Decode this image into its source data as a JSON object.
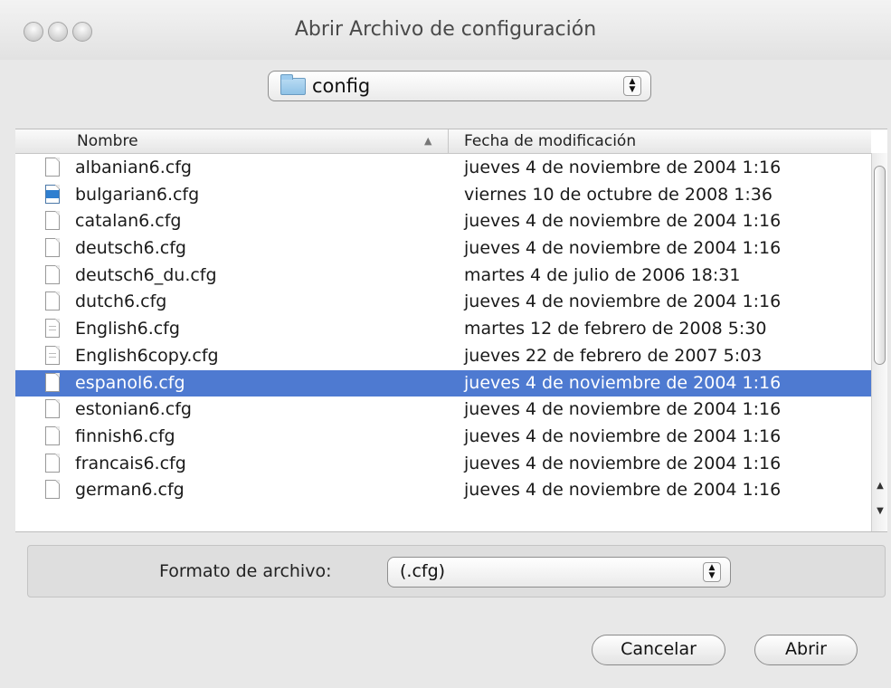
{
  "window": {
    "title": "Abrir Archivo de configuración"
  },
  "location": {
    "folder": "config",
    "stepper_glyph": "▲▼"
  },
  "list": {
    "columns": {
      "name": "Nombre",
      "date": "Fecha de modificación",
      "sort_indicator": "▲"
    },
    "rows": [
      {
        "name": "albanian6.cfg",
        "date": "jueves 4 de noviembre de 2004 1:16",
        "icon": "file-icon"
      },
      {
        "name": "bulgarian6.cfg",
        "date": "viernes 10 de octubre de 2008 1:36",
        "icon": "app-document-icon"
      },
      {
        "name": "catalan6.cfg",
        "date": "jueves 4 de noviembre de 2004 1:16",
        "icon": "file-icon"
      },
      {
        "name": "deutsch6.cfg",
        "date": "jueves 4 de noviembre de 2004 1:16",
        "icon": "file-icon"
      },
      {
        "name": "deutsch6_du.cfg",
        "date": "martes 4 de julio de 2006 18:31",
        "icon": "file-icon"
      },
      {
        "name": "dutch6.cfg",
        "date": "jueves 4 de noviembre de 2004 1:16",
        "icon": "file-icon"
      },
      {
        "name": "English6.cfg",
        "date": "martes 12 de febrero de 2008 5:30",
        "icon": "text-file-icon"
      },
      {
        "name": "English6copy.cfg",
        "date": "jueves 22 de febrero de 2007 5:03",
        "icon": "text-file-icon"
      },
      {
        "name": "espanol6.cfg",
        "date": "jueves 4 de noviembre de 2004 1:16",
        "icon": "file-icon",
        "selected": true
      },
      {
        "name": "estonian6.cfg",
        "date": "jueves 4 de noviembre de 2004 1:16",
        "icon": "file-icon"
      },
      {
        "name": "finnish6.cfg",
        "date": "jueves 4 de noviembre de 2004 1:16",
        "icon": "file-icon"
      },
      {
        "name": "francais6.cfg",
        "date": "jueves 4 de noviembre de 2004 1:16",
        "icon": "file-icon"
      },
      {
        "name": "german6.cfg",
        "date": "jueves 4 de noviembre de 2004 1:16",
        "icon": "file-icon"
      }
    ],
    "selection_color": "#4e7ad1"
  },
  "format": {
    "label": "Formato de archivo:",
    "value": "(.cfg)",
    "stepper_glyph": "▲▼"
  },
  "buttons": {
    "cancel": "Cancelar",
    "open": "Abrir"
  }
}
